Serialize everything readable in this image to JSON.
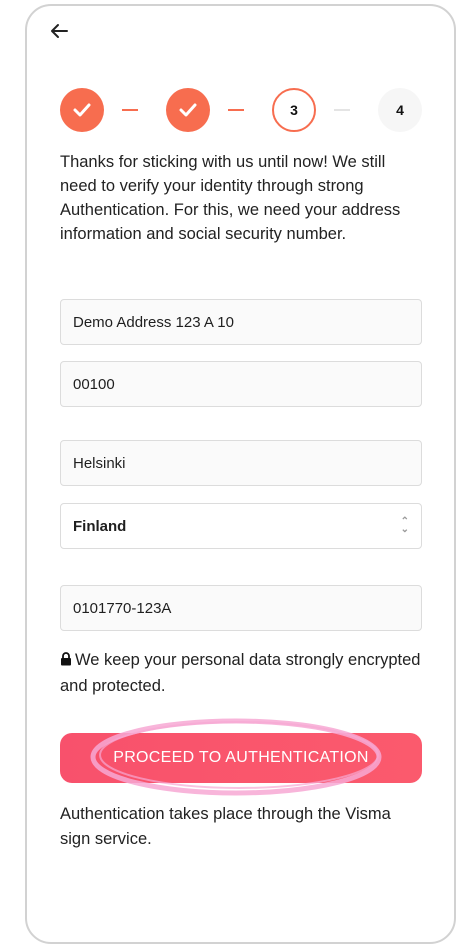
{
  "nav": {
    "back_icon": "arrow-left-icon"
  },
  "stepper": {
    "accent": "#f76d4f",
    "steps": [
      {
        "label": "",
        "state": "done",
        "icon": "check-icon"
      },
      {
        "label": "",
        "state": "done",
        "icon": "check-icon"
      },
      {
        "label": "3",
        "state": "current"
      },
      {
        "label": "4",
        "state": "todo"
      }
    ]
  },
  "intro_text": "Thanks for sticking with us until now! We still need to verify your identity through strong Authentication. For this, we need your address information and social security number.",
  "form": {
    "address": "Demo Address 123 A 10",
    "postal_code": "00100",
    "city": "Helsinki",
    "country": "Finland",
    "ssn": "0101770-123A"
  },
  "privacy_text": "We keep your personal data strongly encrypted and protected.",
  "proceed_button": {
    "label": "PROCEED TO AUTHENTICATION",
    "color": "#f8516c"
  },
  "footer_text": "Authentication takes place through the Visma sign service."
}
